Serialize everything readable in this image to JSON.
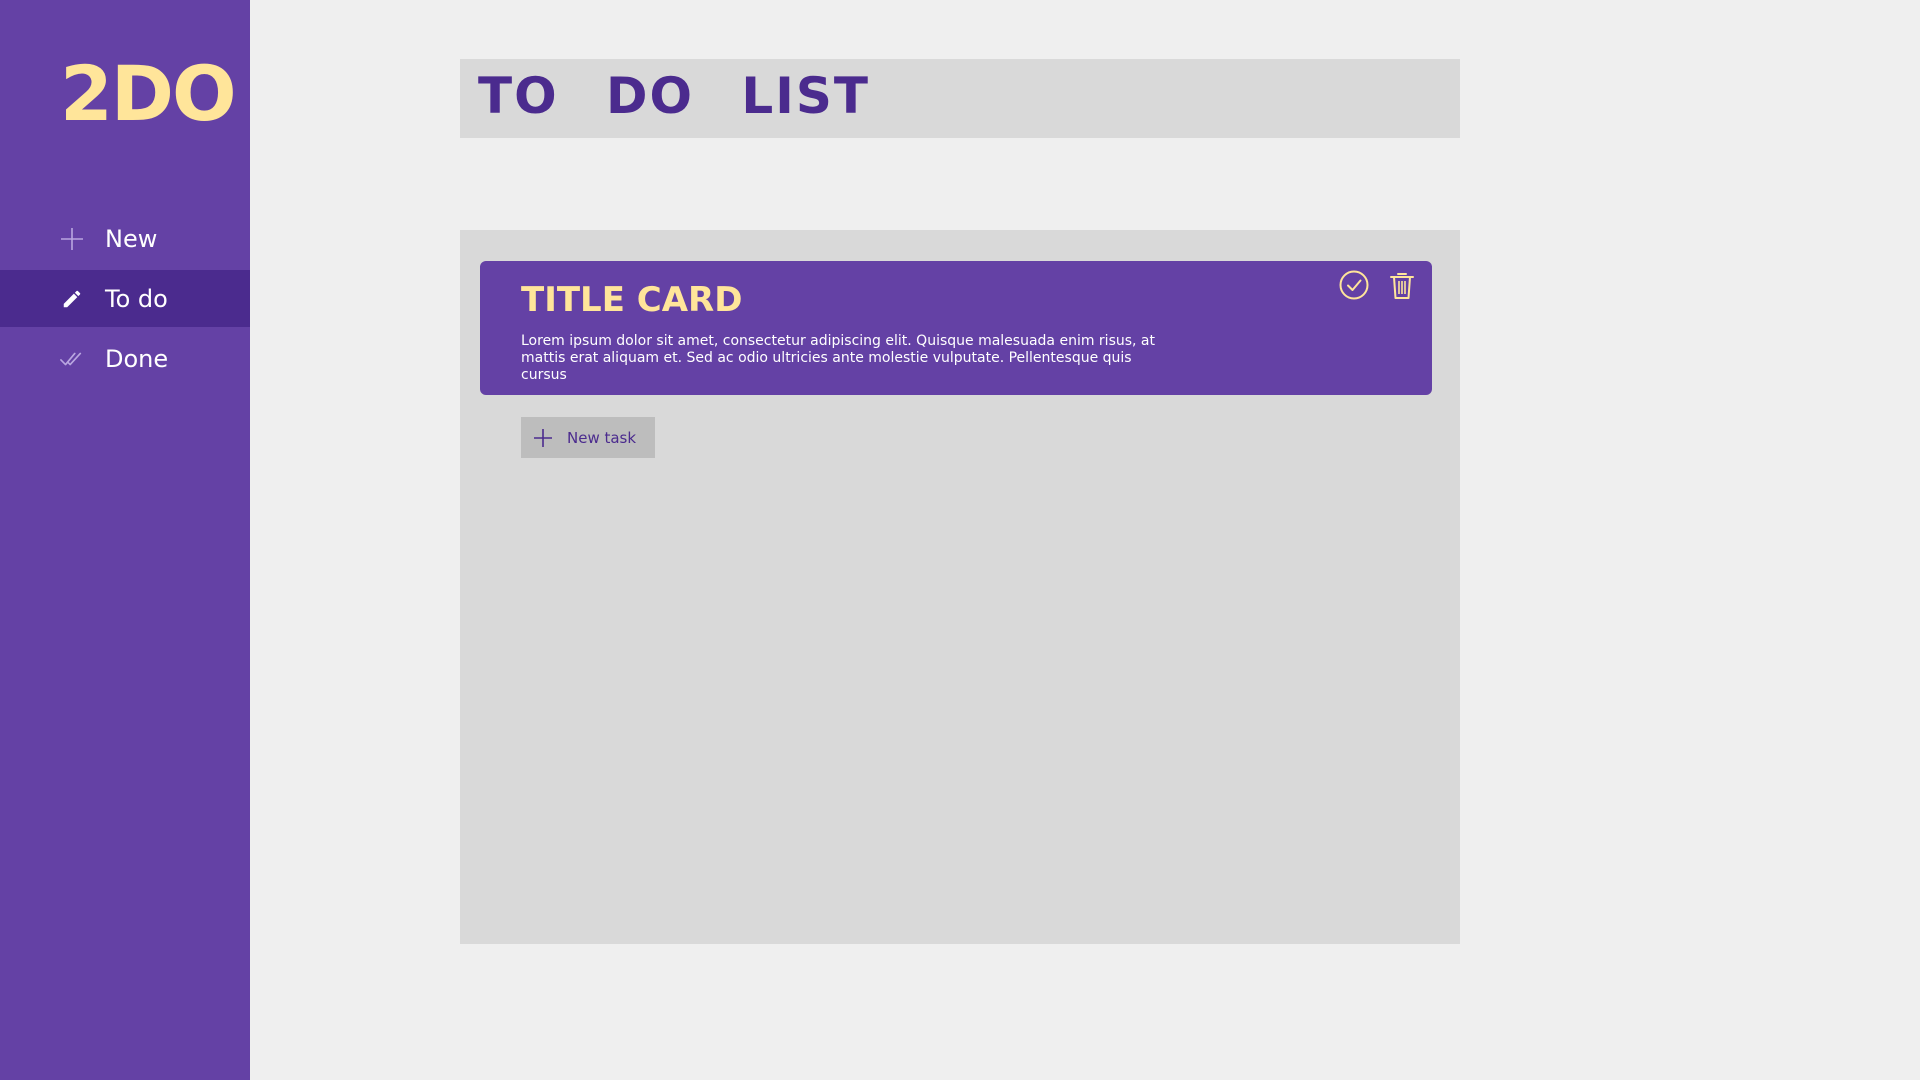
{
  "app": {
    "logo_text": "2DO"
  },
  "sidebar": {
    "items": [
      {
        "label": "New",
        "icon": "plus-icon",
        "active": false
      },
      {
        "label": "To do",
        "icon": "pencil-icon",
        "active": true
      },
      {
        "label": "Done",
        "icon": "double-check-icon",
        "active": false
      }
    ]
  },
  "header": {
    "title": "TO DO LIST"
  },
  "board": {
    "cards": [
      {
        "title": "TITLE CARD",
        "description": "Lorem ipsum dolor sit amet, consectetur adipiscing elit. Quisque malesuada enim risus, at mattis erat aliquam et. Sed ac odio ultricies ante molestie vulputate. Pellentesque quis cursus",
        "actions": [
          "check-circle-icon",
          "trash-icon"
        ]
      }
    ],
    "new_task_label": "New task"
  },
  "colors": {
    "sidebar_bg": "#6441a5",
    "sidebar_active": "#4b2b8e",
    "accent_yellow": "#ffe59a",
    "panel_bg": "#d9d9d9",
    "page_bg": "#efefef",
    "button_bg": "#bdbdbd"
  }
}
